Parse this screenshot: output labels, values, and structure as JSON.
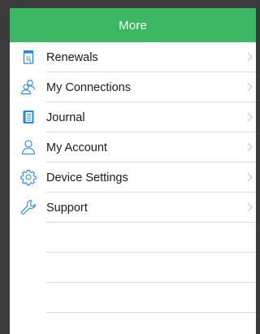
{
  "header": {
    "title": "More"
  },
  "menu": {
    "items": [
      {
        "label": "Renewals",
        "icon": "prescription-icon"
      },
      {
        "label": "My Connections",
        "icon": "connections-icon"
      },
      {
        "label": "Journal",
        "icon": "journal-icon"
      },
      {
        "label": "My Account",
        "icon": "account-icon"
      },
      {
        "label": "Device Settings",
        "icon": "gear-icon"
      },
      {
        "label": "Support",
        "icon": "wrench-icon"
      }
    ]
  },
  "colors": {
    "header_bg": "#3cb865",
    "icon_blue": "#1e88e5",
    "chevron": "#c7c7cc",
    "divider": "#d9d9de",
    "frame_bg": "#3b3b3d"
  }
}
